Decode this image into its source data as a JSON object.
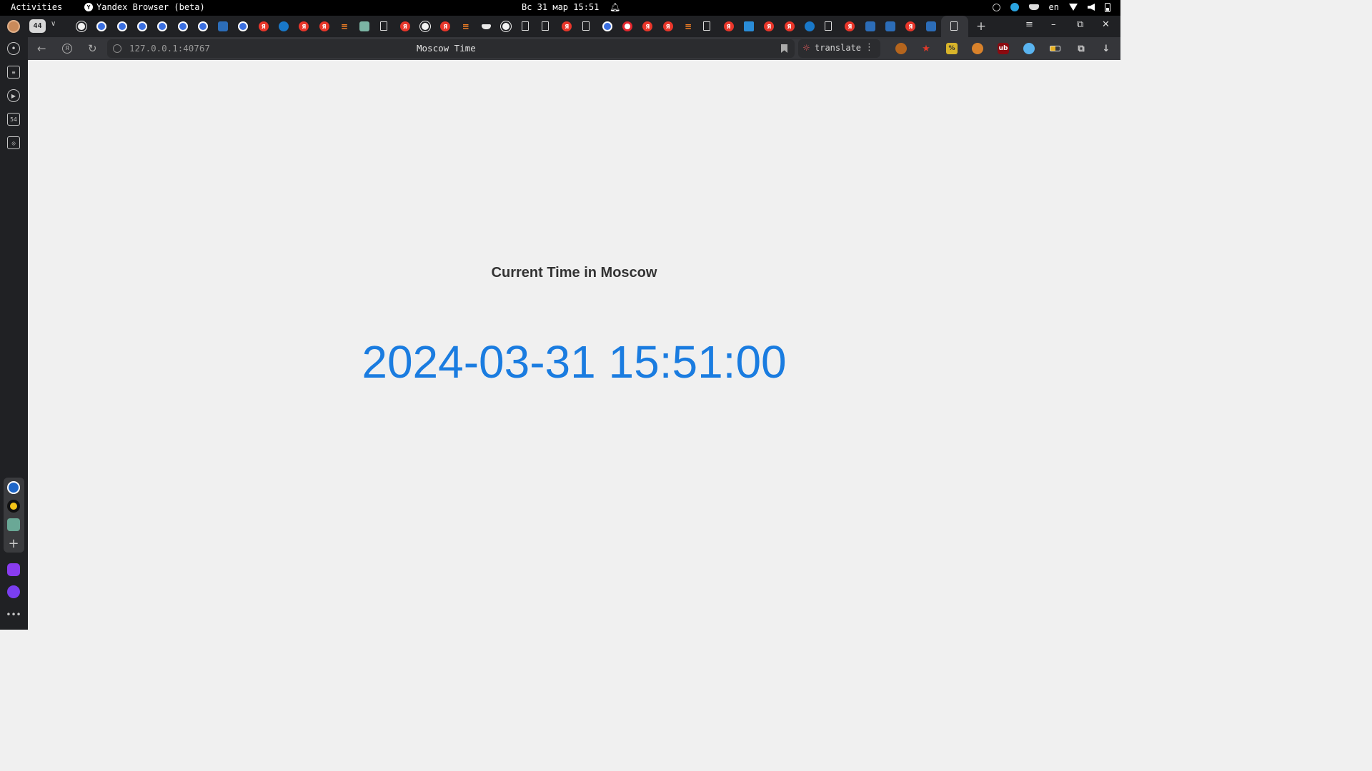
{
  "system_bar": {
    "activities": "Activities",
    "app_name": "Yandex Browser (beta)",
    "datetime": "Вс 31 мар 15:51",
    "language": "en"
  },
  "tabs": {
    "count": "44",
    "favicons": [
      "github",
      "kubernetes",
      "kubernetes",
      "kubernetes",
      "kubernetes",
      "kubernetes",
      "kubernetes",
      "ubuntu",
      "kubernetes",
      "yandex",
      "edge",
      "yandex",
      "yandex",
      "stackoverflow",
      "chatgpt",
      "document",
      "yandex",
      "github",
      "yandex",
      "stackoverflow",
      "docker",
      "github",
      "document",
      "document",
      "yandex",
      "document",
      "kubernetes",
      "ring",
      "yandex",
      "yandex",
      "stackoverflow",
      "document",
      "yandex",
      "tld",
      "yandex",
      "yandex",
      "edge",
      "document",
      "yandex",
      "ubuntu",
      "ubuntu",
      "yandex",
      "ubuntu",
      "document"
    ]
  },
  "toolbar": {
    "url": "127.0.0.1:40767",
    "page_title": "Moscow Time",
    "translate_label": "translate"
  },
  "page": {
    "heading": "Current Time in Moscow",
    "time": "2024-03-31 15:51:00"
  },
  "colors": {
    "time_text": "#1a7ce0",
    "heading_text": "#333333",
    "page_background": "#f0f0f0",
    "browser_chrome": "#35363a"
  }
}
